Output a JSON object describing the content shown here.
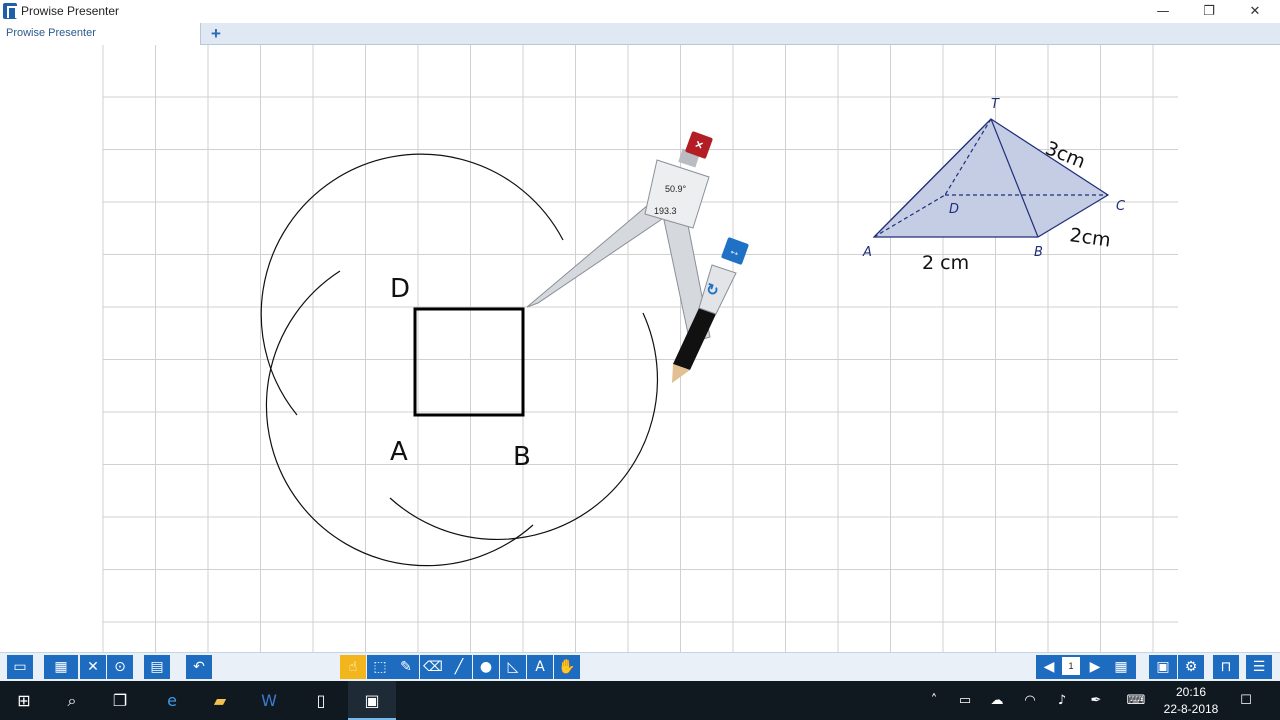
{
  "window": {
    "title": "Prowise Presenter",
    "minimize_glyph": "—",
    "maximize_glyph": "❐",
    "close_glyph": "✕"
  },
  "tabs": {
    "items": [
      {
        "label": "Prowise Presenter"
      }
    ],
    "add_glyph": "+"
  },
  "canvas": {
    "square_labels": {
      "D": "D",
      "A": "A",
      "B": "B"
    },
    "pyramid_labels": {
      "T": "T",
      "D": "D",
      "C": "C",
      "A": "A",
      "B": "B"
    },
    "pyramid_dimensions": {
      "tc": "3cm",
      "ab": "2 cm",
      "bc": "2cm"
    },
    "pyramid_fill": "#c5cde4",
    "pyramid_stroke": "#1f2f7a",
    "grid_color": "#d0d0d0"
  },
  "compass": {
    "angle": "50.9°",
    "radius": "193.3",
    "close_icon": "×",
    "resize_icon": "↔",
    "rotate_icon": "↻"
  },
  "toolbar": {
    "left": [
      "folder-icon",
      "pictures-icon",
      "tools-icon",
      "zoom-icon",
      "pages-icon",
      "undo-icon"
    ],
    "center": [
      "pointer-icon",
      "select-icon",
      "pen-icon",
      "eraser-icon",
      "line-icon",
      "shape-icon",
      "ruler-icon",
      "text-icon",
      "hand-icon"
    ],
    "right": [
      "prev-page-icon",
      "page-number",
      "next-page-icon",
      "grid-view-icon",
      "screen-icon",
      "settings-icon",
      "presenter-icon",
      "menu-icon"
    ],
    "page": "1",
    "accent": "#1d6cc0",
    "active_color": "#f2b51b"
  },
  "taskbar": {
    "apps": [
      "windows-start-icon",
      "search-icon",
      "task-view-icon",
      "edge-icon",
      "file-explorer-icon",
      "word-icon",
      "notepad-icon",
      "prowise-icon"
    ],
    "time": "20:16",
    "date": "22-8-2018"
  }
}
